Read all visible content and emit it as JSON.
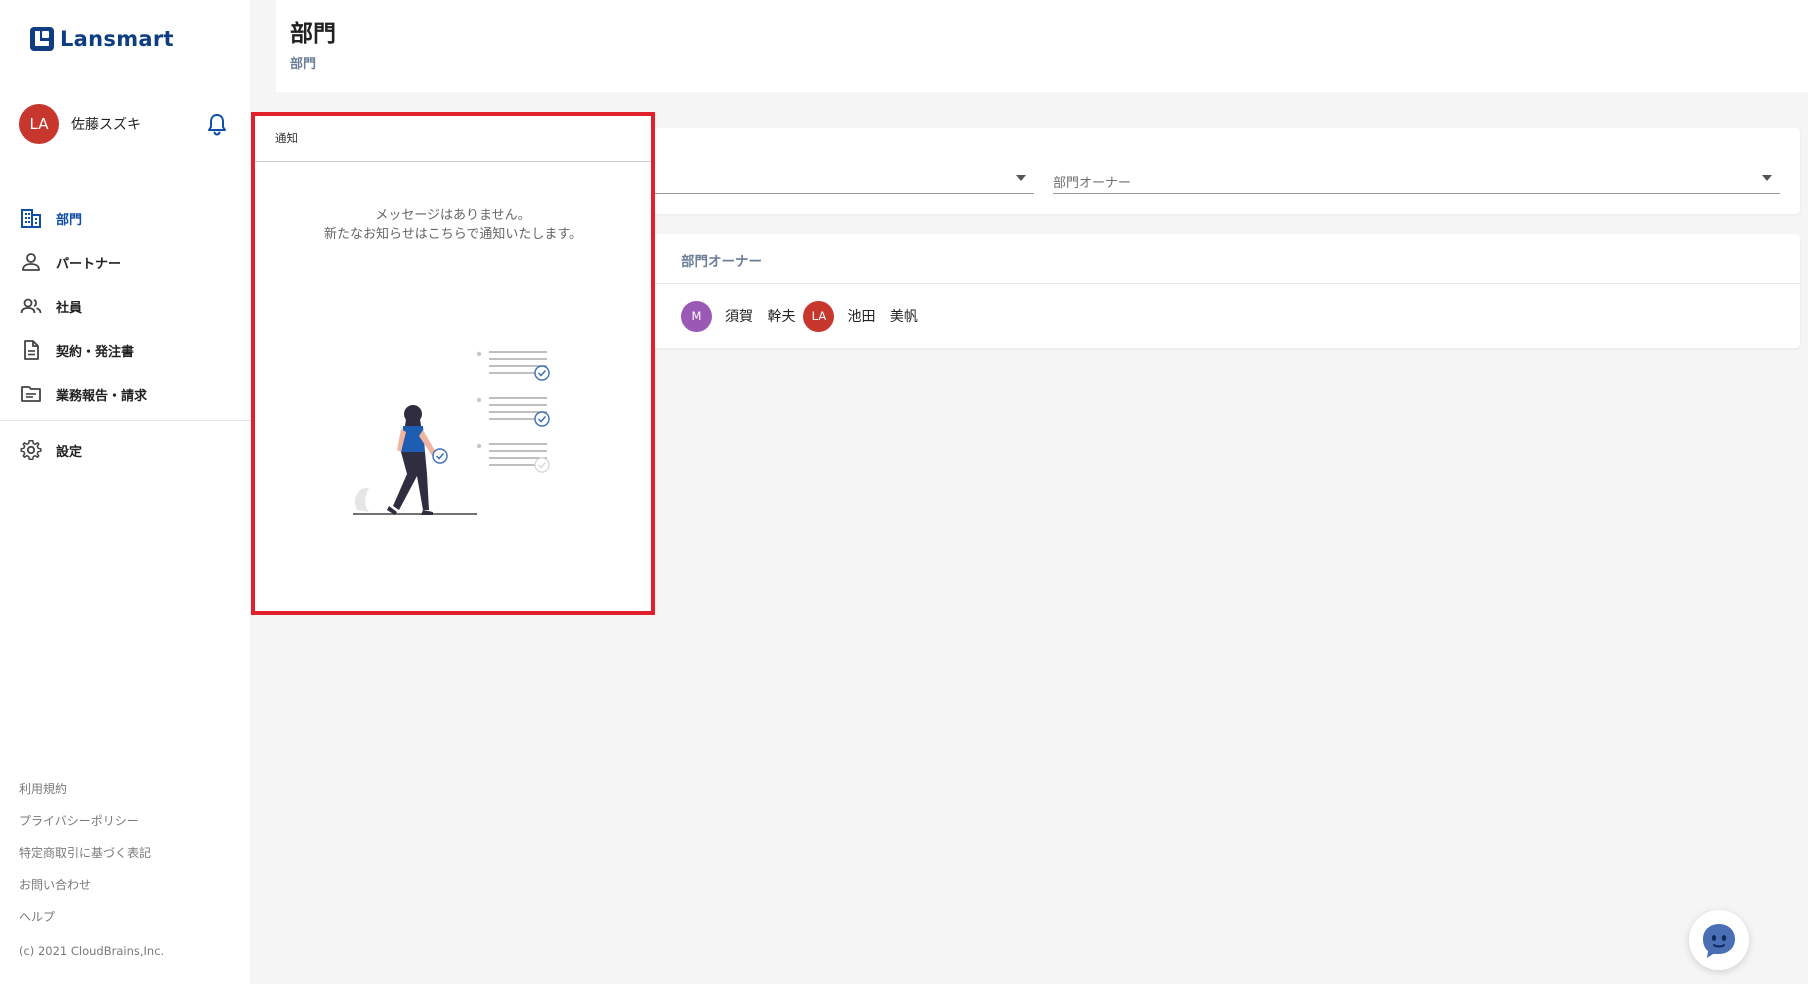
{
  "app": {
    "logo_text": "Lansmart"
  },
  "user": {
    "avatar_initials": "LA",
    "name": "佐藤スズキ"
  },
  "nav": {
    "items": [
      {
        "label": "部門",
        "icon": "building-icon",
        "active": true
      },
      {
        "label": "パートナー",
        "icon": "person-icon"
      },
      {
        "label": "社員",
        "icon": "people-icon"
      },
      {
        "label": "契約・発注書",
        "icon": "document-icon"
      },
      {
        "label": "業務報告・請求",
        "icon": "folder-icon"
      }
    ],
    "settings": {
      "label": "設定",
      "icon": "gear-icon"
    }
  },
  "footer": {
    "links": [
      "利用規約",
      "プライバシーポリシー",
      "特定商取引に基づく表記",
      "お問い合わせ",
      "ヘルプ"
    ],
    "copyright": "(c) 2021 CloudBrains,Inc."
  },
  "header": {
    "title": "部門",
    "breadcrumb": "部門"
  },
  "filters": {
    "owner_placeholder": "部門オーナー"
  },
  "table": {
    "columns": [
      "部門オーナー"
    ],
    "rows": [
      {
        "owners": [
          {
            "initials": "M",
            "name": "須賀 幹夫",
            "color": "#9b59b6"
          },
          {
            "initials": "LA",
            "name": "池田 美帆",
            "color": "#c8372d"
          }
        ]
      }
    ]
  },
  "notification": {
    "title": "通知",
    "empty_line1": "メッセージはありません。",
    "empty_line2": "新たなお知らせはこちらで通知いたします。"
  },
  "colors": {
    "brand": "#0f3d82",
    "active": "#0f4fa8",
    "highlight": "#e0202a"
  }
}
